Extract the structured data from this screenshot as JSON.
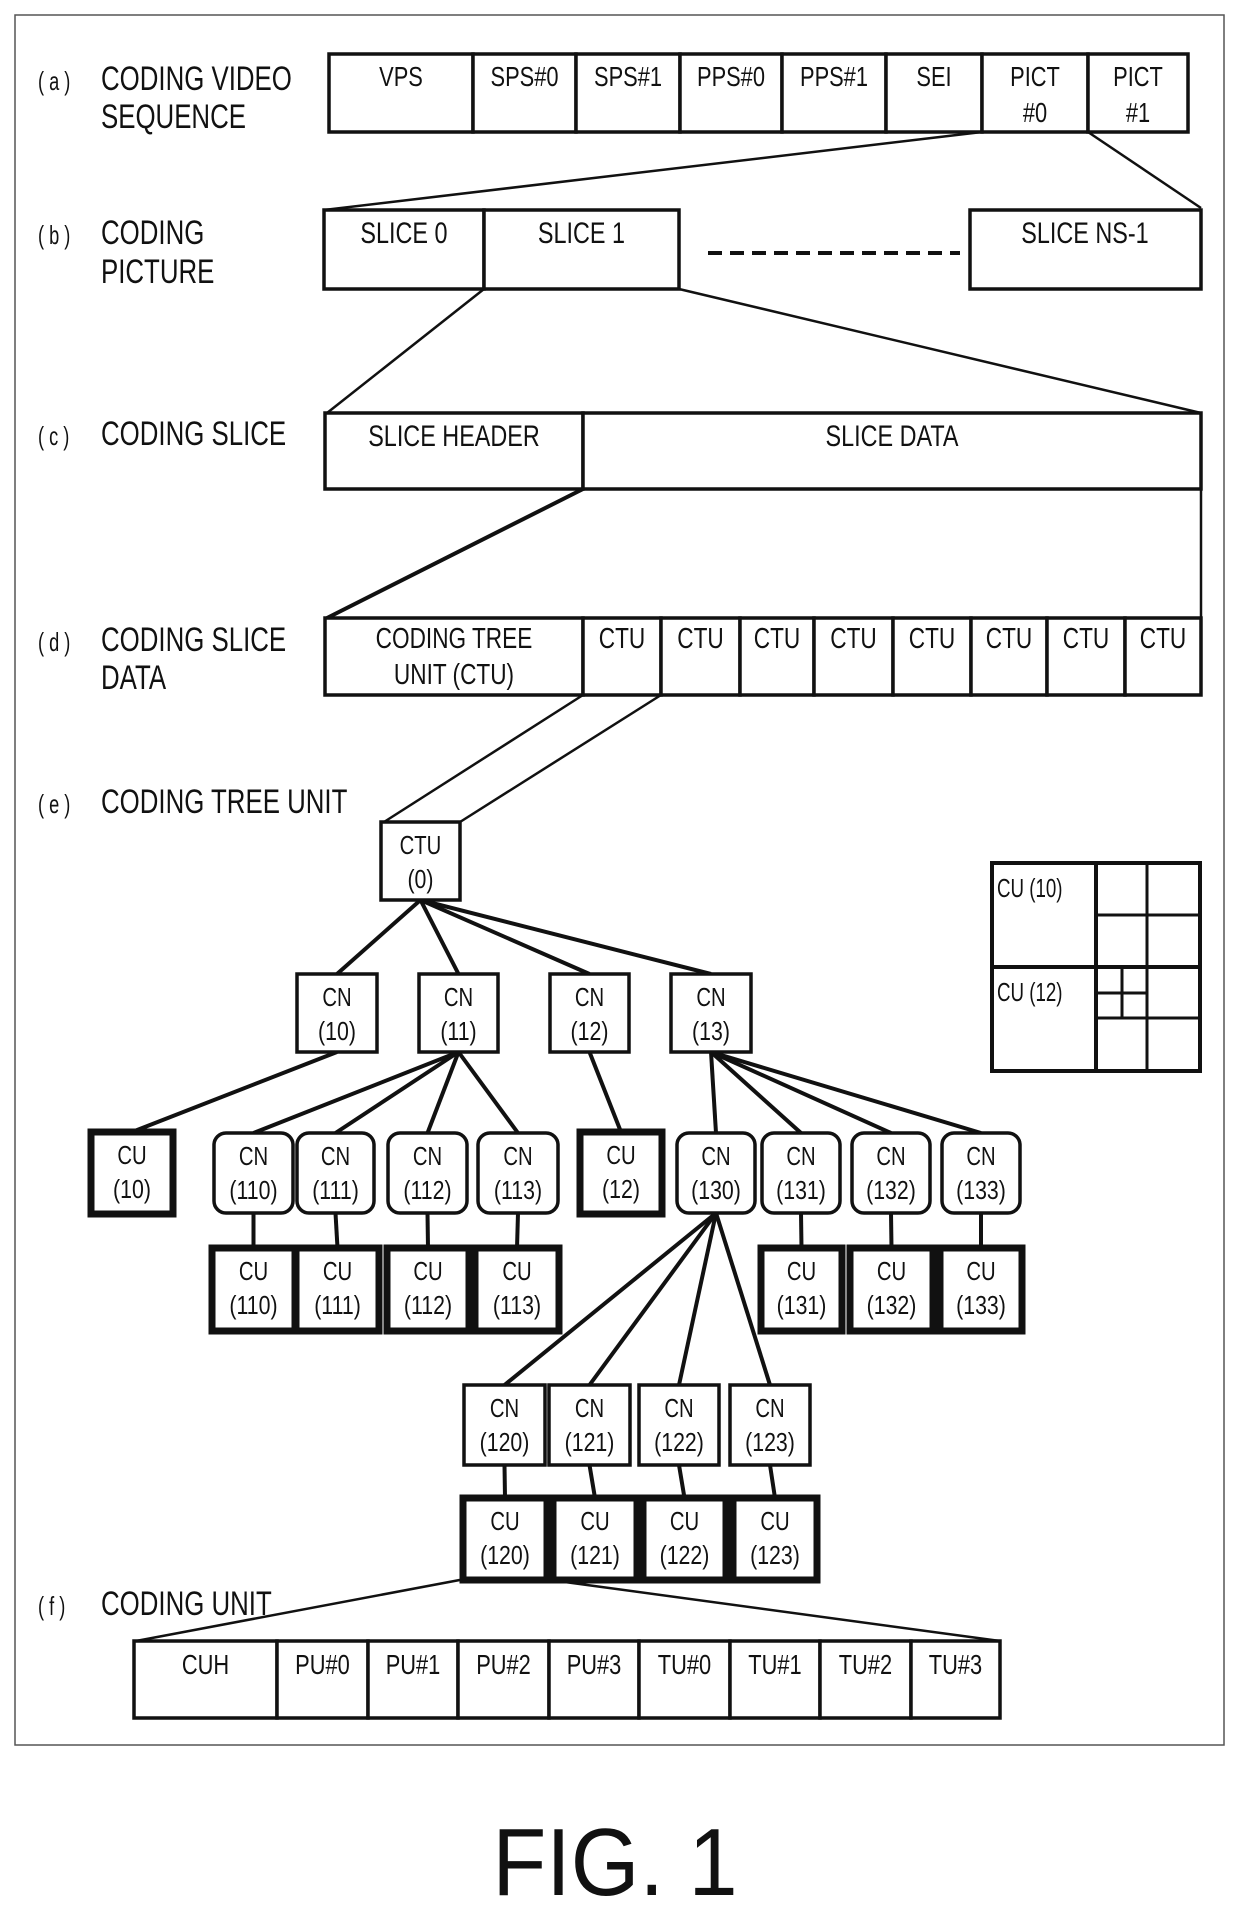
{
  "figure": {
    "caption": "FIG. 1"
  },
  "sections": {
    "a": {
      "marker": "( a )",
      "title_lines": [
        "CODING VIDEO",
        "SEQUENCE"
      ]
    },
    "b": {
      "marker": "( b )",
      "title_lines": [
        "CODING",
        "PICTURE"
      ]
    },
    "c": {
      "marker": "( c )",
      "title_lines": [
        "CODING SLICE"
      ]
    },
    "d": {
      "marker": "( d )",
      "title_lines": [
        "CODING SLICE",
        "DATA"
      ]
    },
    "e": {
      "marker": "( e )",
      "title_lines": [
        "CODING TREE UNIT"
      ]
    },
    "f": {
      "marker": "( f )",
      "title_lines": [
        "CODING UNIT"
      ]
    }
  },
  "sequence_row": {
    "cells": [
      [
        "VPS"
      ],
      [
        "SPS#0"
      ],
      [
        "SPS#1"
      ],
      [
        "PPS#0"
      ],
      [
        "PPS#1"
      ],
      [
        "SEI"
      ],
      [
        "PICT",
        "#0"
      ],
      [
        "PICT",
        "#1"
      ]
    ]
  },
  "picture_row": {
    "cells": [
      [
        "SLICE 0"
      ],
      [
        "SLICE 1"
      ]
    ],
    "last_cell": [
      "SLICE NS-1"
    ],
    "ellipsis": "dashed-line"
  },
  "slice_row": {
    "cells": [
      [
        "SLICE HEADER"
      ],
      [
        "SLICE DATA"
      ]
    ]
  },
  "slice_data_row": {
    "cells": [
      [
        "CODING TREE",
        "UNIT (CTU)"
      ],
      [
        "CTU"
      ],
      [
        "CTU"
      ],
      [
        "CTU"
      ],
      [
        "CTU"
      ],
      [
        "CTU"
      ],
      [
        "CTU"
      ],
      [
        "CTU"
      ],
      [
        "CTU"
      ]
    ]
  },
  "tree": {
    "nodes": {
      "ctu0": {
        "kind": "CTU",
        "id": "(0)",
        "style": "square"
      },
      "cn10": {
        "kind": "CN",
        "id": "(10)",
        "style": "square"
      },
      "cn11": {
        "kind": "CN",
        "id": "(11)",
        "style": "square"
      },
      "cn12": {
        "kind": "CN",
        "id": "(12)",
        "style": "square"
      },
      "cn13": {
        "kind": "CN",
        "id": "(13)",
        "style": "square"
      },
      "cu10": {
        "kind": "CU",
        "id": "(10)",
        "style": "leaf"
      },
      "cn110": {
        "kind": "CN",
        "id": "(110)",
        "style": "rounded"
      },
      "cn111": {
        "kind": "CN",
        "id": "(111)",
        "style": "rounded"
      },
      "cn112": {
        "kind": "CN",
        "id": "(112)",
        "style": "rounded"
      },
      "cn113": {
        "kind": "CN",
        "id": "(113)",
        "style": "rounded"
      },
      "cu12": {
        "kind": "CU",
        "id": "(12)",
        "style": "leaf"
      },
      "cn130": {
        "kind": "CN",
        "id": "(130)",
        "style": "rounded"
      },
      "cn131": {
        "kind": "CN",
        "id": "(131)",
        "style": "rounded"
      },
      "cn132": {
        "kind": "CN",
        "id": "(132)",
        "style": "rounded"
      },
      "cn133": {
        "kind": "CN",
        "id": "(133)",
        "style": "rounded"
      },
      "cu110": {
        "kind": "CU",
        "id": "(110)",
        "style": "leaf"
      },
      "cu111": {
        "kind": "CU",
        "id": "(111)",
        "style": "leaf"
      },
      "cu112": {
        "kind": "CU",
        "id": "(112)",
        "style": "leaf"
      },
      "cu113": {
        "kind": "CU",
        "id": "(113)",
        "style": "leaf"
      },
      "cu131": {
        "kind": "CU",
        "id": "(131)",
        "style": "leaf"
      },
      "cu132": {
        "kind": "CU",
        "id": "(132)",
        "style": "leaf"
      },
      "cu133": {
        "kind": "CU",
        "id": "(133)",
        "style": "leaf"
      },
      "cn120": {
        "kind": "CN",
        "id": "(120)",
        "style": "square"
      },
      "cn121": {
        "kind": "CN",
        "id": "(121)",
        "style": "square"
      },
      "cn122": {
        "kind": "CN",
        "id": "(122)",
        "style": "square"
      },
      "cn123": {
        "kind": "CN",
        "id": "(123)",
        "style": "square"
      },
      "cu120": {
        "kind": "CU",
        "id": "(120)",
        "style": "leaf"
      },
      "cu121": {
        "kind": "CU",
        "id": "(121)",
        "style": "leaf"
      },
      "cu122": {
        "kind": "CU",
        "id": "(122)",
        "style": "leaf"
      },
      "cu123": {
        "kind": "CU",
        "id": "(123)",
        "style": "leaf"
      }
    },
    "edges": [
      [
        "ctu0",
        "cn10"
      ],
      [
        "ctu0",
        "cn11"
      ],
      [
        "ctu0",
        "cn12"
      ],
      [
        "ctu0",
        "cn13"
      ],
      [
        "cn10",
        "cu10"
      ],
      [
        "cn11",
        "cn110"
      ],
      [
        "cn11",
        "cn111"
      ],
      [
        "cn11",
        "cn112"
      ],
      [
        "cn11",
        "cn113"
      ],
      [
        "cn12",
        "cu12"
      ],
      [
        "cn13",
        "cn130"
      ],
      [
        "cn13",
        "cn131"
      ],
      [
        "cn13",
        "cn132"
      ],
      [
        "cn13",
        "cn133"
      ],
      [
        "cn110",
        "cu110"
      ],
      [
        "cn111",
        "cu111"
      ],
      [
        "cn112",
        "cu112"
      ],
      [
        "cn113",
        "cu113"
      ],
      [
        "cn131",
        "cu131"
      ],
      [
        "cn132",
        "cu132"
      ],
      [
        "cn133",
        "cu133"
      ],
      [
        "cn130",
        "cn120"
      ],
      [
        "cn130",
        "cn121"
      ],
      [
        "cn130",
        "cn122"
      ],
      [
        "cn130",
        "cn123"
      ],
      [
        "cn120",
        "cu120"
      ],
      [
        "cn121",
        "cu121"
      ],
      [
        "cn122",
        "cu122"
      ],
      [
        "cn123",
        "cu123"
      ]
    ]
  },
  "partition_inset": {
    "labels": [
      "CU (10)",
      "CU (12)"
    ]
  },
  "coding_unit_row": {
    "cells": [
      [
        "CUH"
      ],
      [
        "PU#0"
      ],
      [
        "PU#1"
      ],
      [
        "PU#2"
      ],
      [
        "PU#3"
      ],
      [
        "TU#0"
      ],
      [
        "TU#1"
      ],
      [
        "TU#2"
      ],
      [
        "TU#3"
      ]
    ]
  }
}
